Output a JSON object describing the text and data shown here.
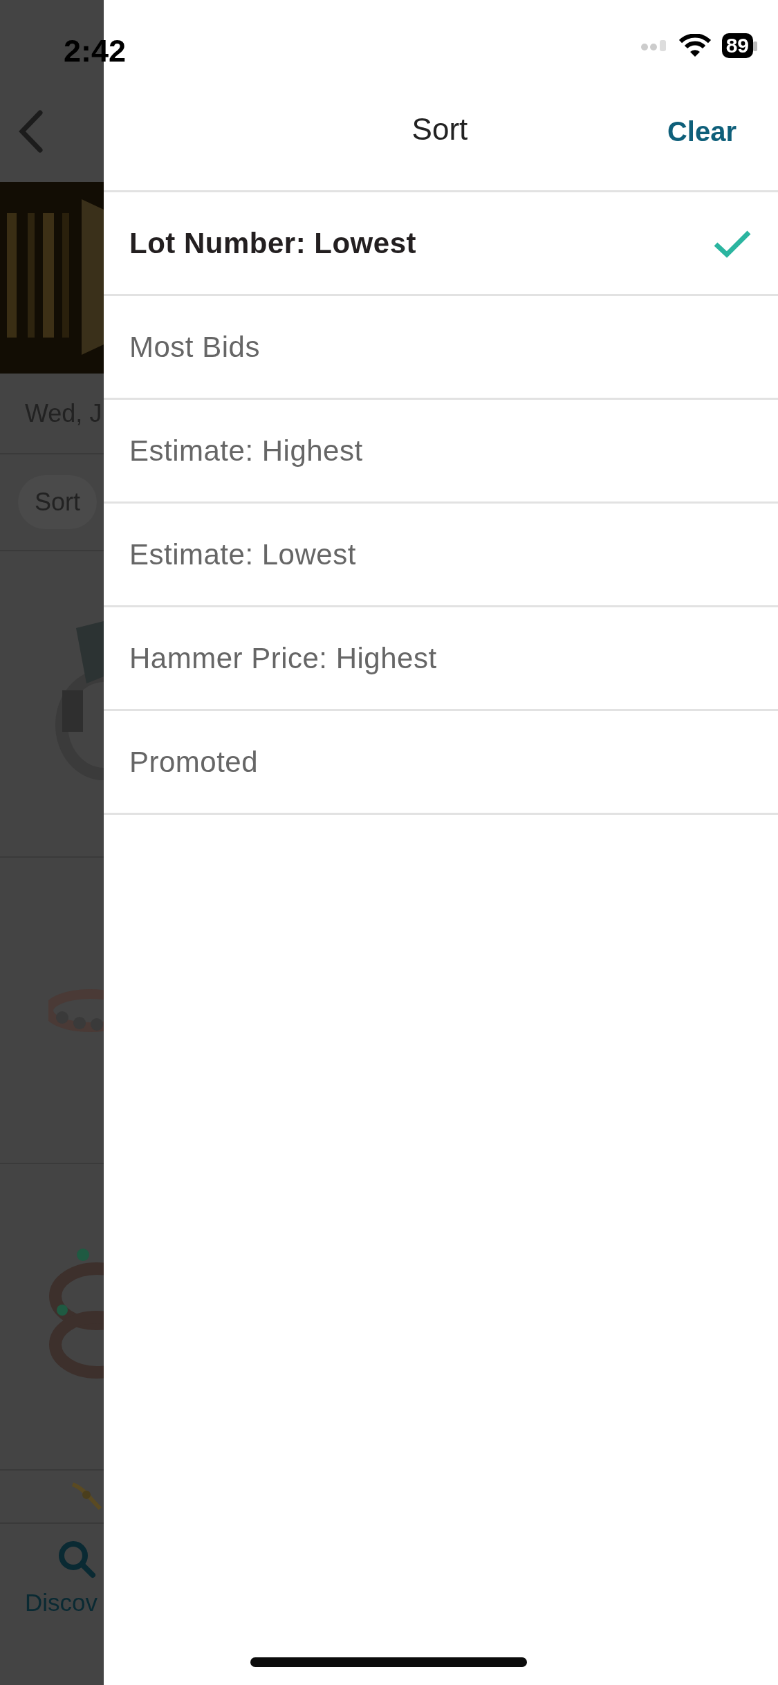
{
  "status_bar": {
    "time": "2:42",
    "battery": "89"
  },
  "background_page": {
    "date": "Wed, J",
    "sort_chip": "Sort",
    "tab_bar": [
      {
        "label": "Discov",
        "selected": true
      }
    ]
  },
  "sort_sheet": {
    "title": "Sort",
    "clear": "Clear",
    "options": [
      {
        "label": "Lot Number: Lowest",
        "selected": true
      },
      {
        "label": "Most Bids",
        "selected": false
      },
      {
        "label": "Estimate: Highest",
        "selected": false
      },
      {
        "label": "Estimate: Lowest",
        "selected": false
      },
      {
        "label": "Hammer Price: Highest",
        "selected": false
      },
      {
        "label": "Promoted",
        "selected": false
      }
    ]
  }
}
